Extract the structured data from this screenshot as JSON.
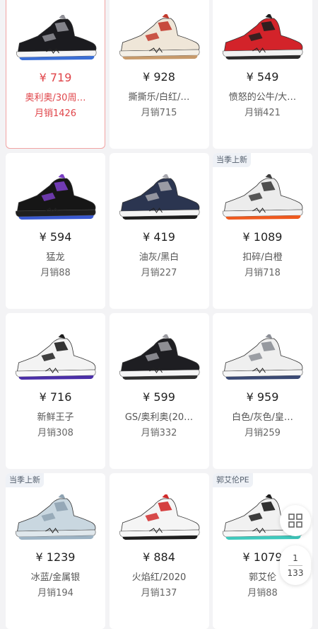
{
  "products": [
    {
      "price": "¥ 719",
      "name": "奥利奥/30周…",
      "sales": "月销1426",
      "badge": "",
      "selected": true,
      "colors": {
        "upper": "#1b1b1f",
        "accent": "#8f8f96",
        "sole": "#f5f5f5",
        "outsole": "#3b6fd6"
      }
    },
    {
      "price": "¥ 928",
      "name": "撕撕乐/白红/…",
      "sales": "月销715",
      "badge": "",
      "colors": {
        "upper": "#efe6d8",
        "accent": "#c23a2d",
        "sole": "#f4efe6",
        "outsole": "#c79a6b"
      }
    },
    {
      "price": "¥ 549",
      "name": "愤怒的公牛/大…",
      "sales": "月销421",
      "badge": "",
      "colors": {
        "upper": "#d3232a",
        "accent": "#1e1e1e",
        "sole": "#f2f2f2",
        "outsole": "#2b2b2b"
      }
    },
    {
      "price": "¥ 594",
      "name": "猛龙",
      "sales": "月销88",
      "badge": "",
      "colors": {
        "upper": "#161616",
        "accent": "#7a3fc4",
        "sole": "#1f1f1f",
        "outsole": "#3959d1"
      }
    },
    {
      "price": "¥ 419",
      "name": "油灰/黑白",
      "sales": "月销227",
      "badge": "",
      "colors": {
        "upper": "#2b3550",
        "accent": "#a6a6ad",
        "sole": "#f4f4f4",
        "outsole": "#1d1d1d"
      }
    },
    {
      "price": "¥ 1089",
      "name": "扣碎/白橙",
      "sales": "月销718",
      "badge": "当季上新",
      "colors": {
        "upper": "#ececec",
        "accent": "#3d3d3d",
        "sole": "#f3f3f3",
        "outsole": "#ef5a1f"
      }
    },
    {
      "price": "¥ 716",
      "name": "新鲜王子",
      "sales": "月销308",
      "badge": "",
      "colors": {
        "upper": "#f3f3f3",
        "accent": "#1e1e1e",
        "sole": "#f8f8f8",
        "outsole": "#4b2fa8"
      }
    },
    {
      "price": "¥ 599",
      "name": "GS/奥利奥(20…",
      "sales": "月销332",
      "badge": "",
      "colors": {
        "upper": "#1e1e22",
        "accent": "#9a9aa0",
        "sole": "#f5f5f5",
        "outsole": "#2f2f2f"
      }
    },
    {
      "price": "¥ 959",
      "name": "白色/灰色/皇…",
      "sales": "月销259",
      "badge": "",
      "colors": {
        "upper": "#efefef",
        "accent": "#8c8f96",
        "sole": "#f6f6f6",
        "outsole": "#3b4a74"
      }
    },
    {
      "price": "¥ 1239",
      "name": "冰蓝/金属银",
      "sales": "月销194",
      "badge": "当季上新",
      "colors": {
        "upper": "#c9d7e0",
        "accent": "#8fa3b2",
        "sole": "#dfe7ec",
        "outsole": "#9db3c4"
      }
    },
    {
      "price": "¥ 884",
      "name": "火焰红/2020",
      "sales": "月销137",
      "badge": "",
      "colors": {
        "upper": "#f5f5f5",
        "accent": "#d12b2b",
        "sole": "#f7f7f7",
        "outsole": "#1e1e1e"
      }
    },
    {
      "price": "¥ 1079",
      "name": "郭艾伦",
      "sales": "月销88",
      "badge": "郭艾伦PE",
      "colors": {
        "upper": "#f1f1f1",
        "accent": "#1c1c1c",
        "sole": "#f6f6f6",
        "outsole": "#3fc9bd"
      }
    }
  ],
  "pager": {
    "current": "1",
    "total": "133"
  },
  "icons": {
    "grid_view": "grid-view-icon"
  }
}
